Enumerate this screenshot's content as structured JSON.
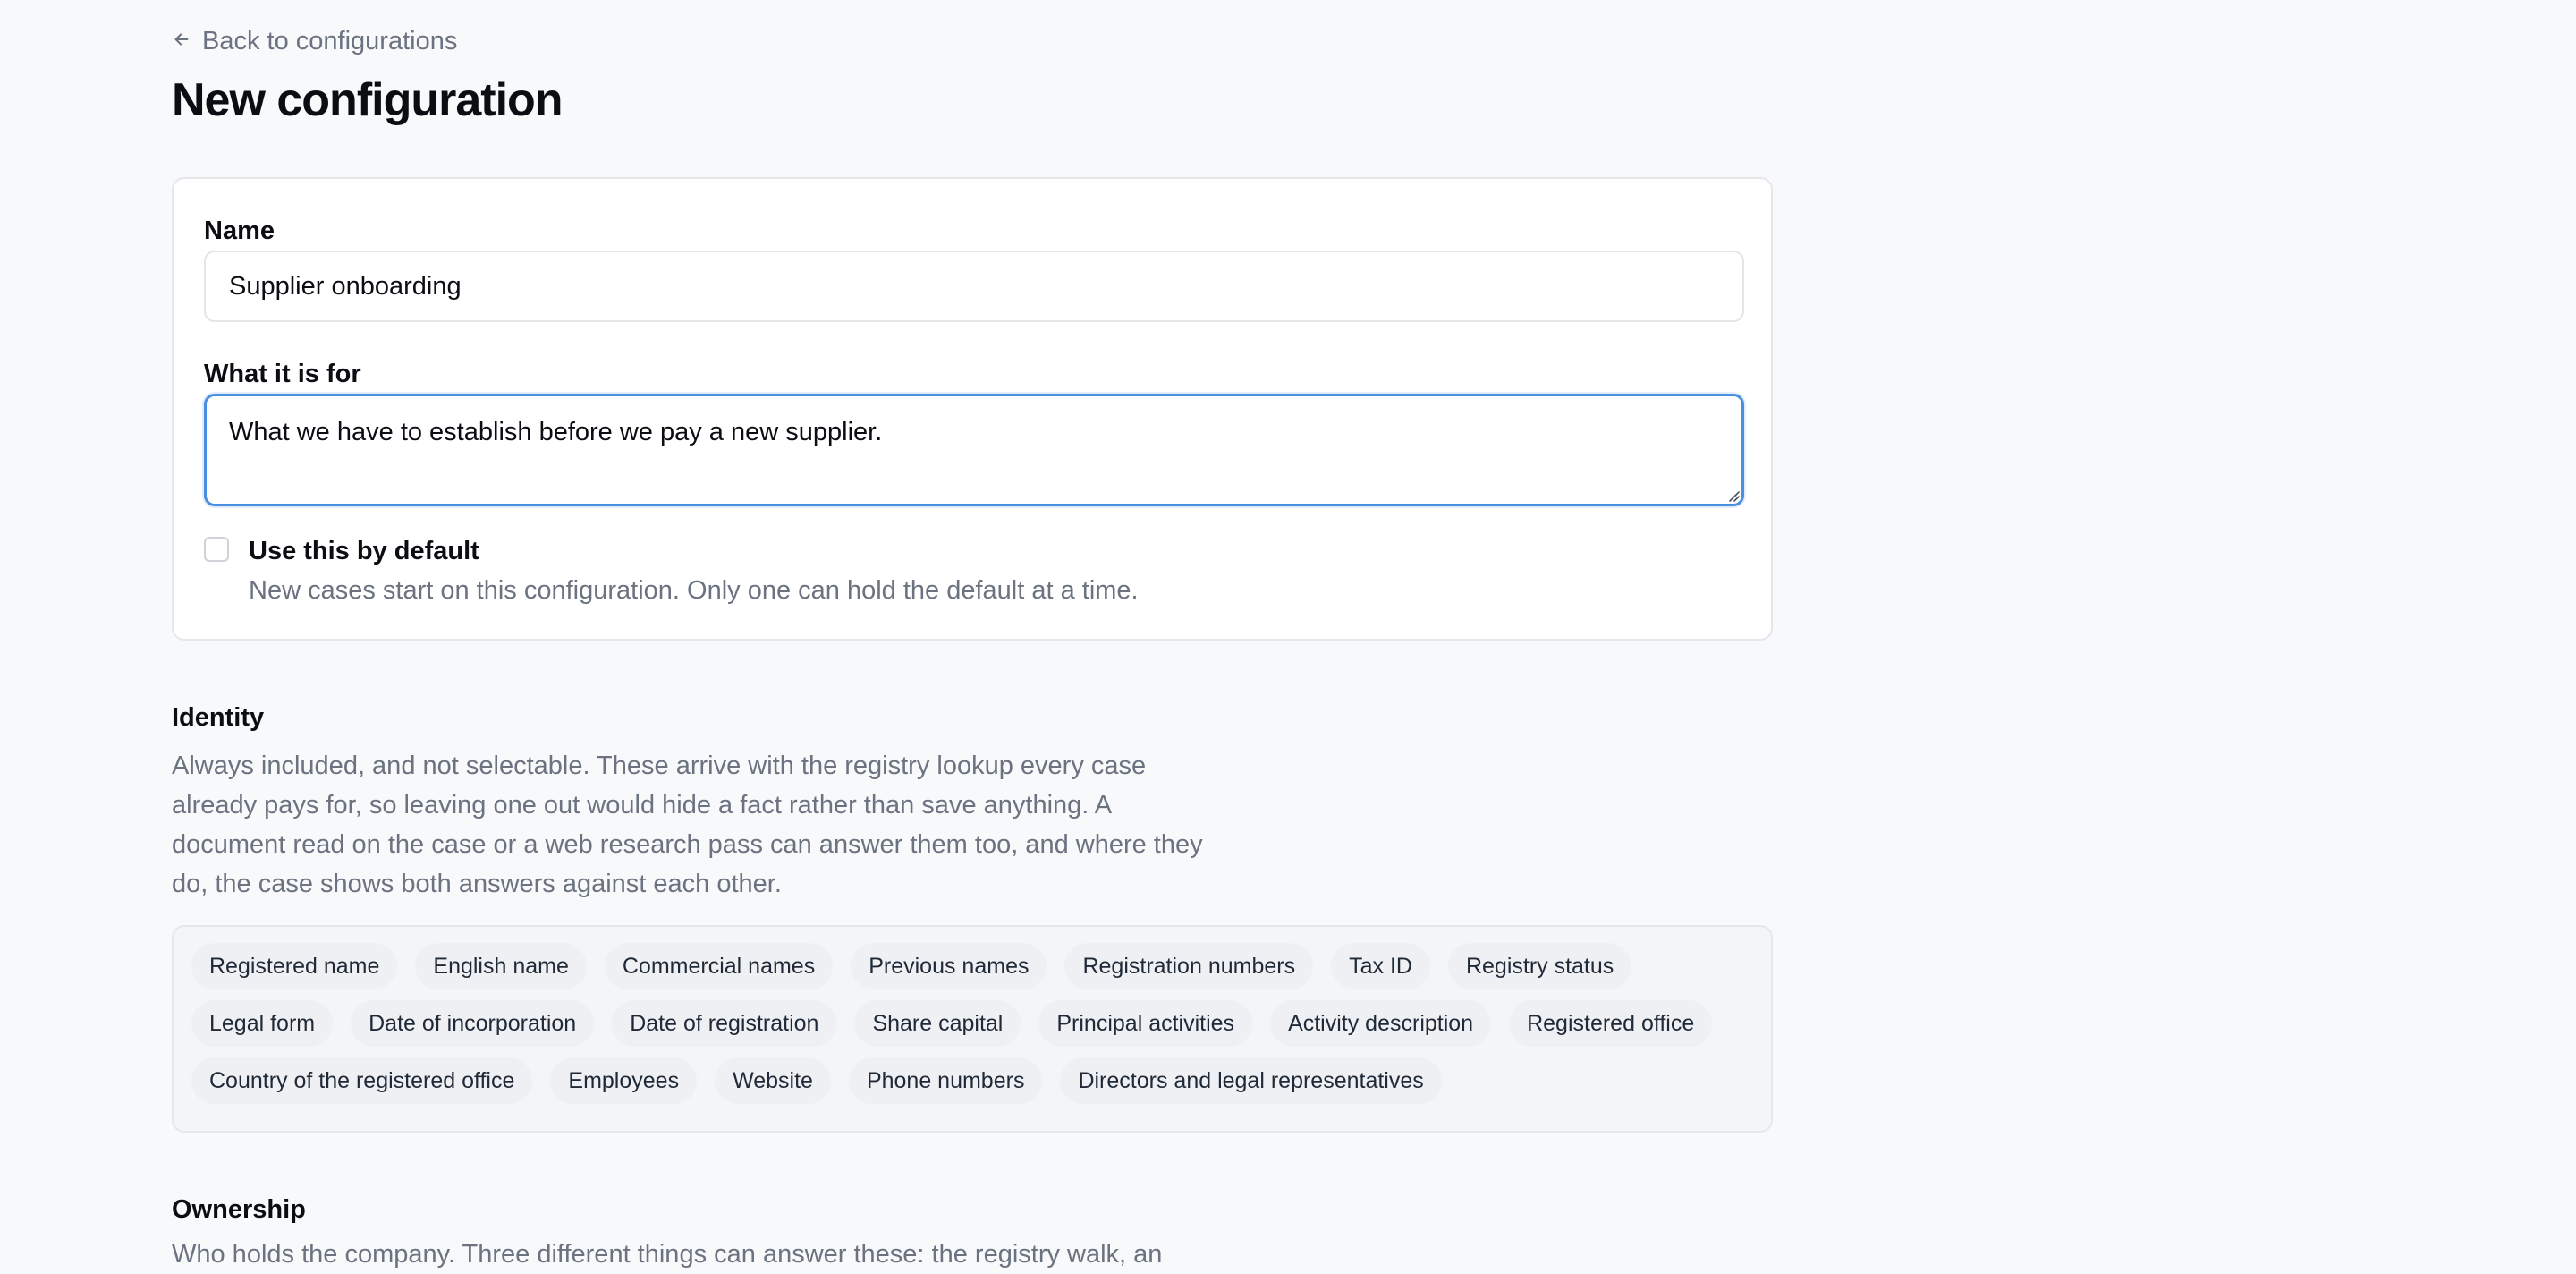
{
  "back_link": {
    "label": "Back to configurations",
    "icon": "arrow-left-icon"
  },
  "page_title": "New configuration",
  "form": {
    "name_label": "Name",
    "name_value": "Supplier onboarding",
    "purpose_label": "What it is for",
    "purpose_value": "What we have to establish before we pay a new supplier.",
    "default_checkbox": {
      "checked": false,
      "label": "Use this by default",
      "help": "New cases start on this configuration. Only one can hold the default at a time."
    }
  },
  "identity": {
    "title": "Identity",
    "description": "Always included, and not selectable. These arrive with the registry lookup every case already pays for, so leaving one out would hide a fact rather than save anything. A document read on the case or a web research pass can answer them too, and where they do, the case shows both answers against each other.",
    "fields": [
      [
        "Registered name",
        "English name",
        "Commercial names",
        "Previous names",
        "Registration numbers",
        "Tax ID",
        "Registry status"
      ],
      [
        "Legal form",
        "Date of incorporation",
        "Date of registration",
        "Share capital",
        "Principal activities",
        "Activity description",
        "Registered office"
      ],
      [
        "Country of the registered office",
        "Employees",
        "Website",
        "Phone numbers",
        "Directors and legal representatives"
      ]
    ]
  },
  "ownership": {
    "title": "Ownership",
    "description": "Who holds the company. Three different things can answer these: the registry walk, an"
  },
  "colors": {
    "background": "#f8f9fb",
    "focus_ring": "#4a90e2",
    "muted_text": "#6b7280"
  }
}
